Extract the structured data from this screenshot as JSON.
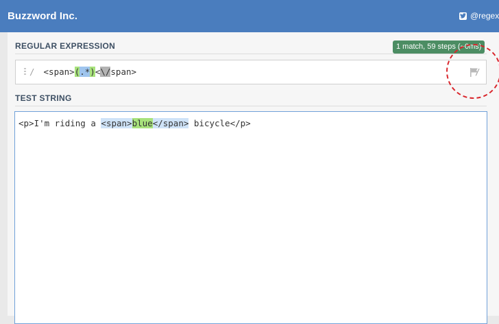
{
  "header": {
    "brand": "Buzzword Inc.",
    "twitter_handle": "@regex",
    "twitter_icon": "twitter-icon",
    "background_color": "#4a7dbe"
  },
  "regex_section": {
    "title": "REGULAR EXPRESSION",
    "match_info": "1 match, 59 steps (~0ms)",
    "match_info_color": "#4c8d63",
    "delimiter_open": "/",
    "delimiter_close": "/",
    "parts": {
      "prefix": " <span>",
      "group_open": "(",
      "token": ".*",
      "group_close": ")",
      "lt": "<",
      "escape": "\\/",
      "suffix": "span>"
    },
    "flags_icon": "flag-icon"
  },
  "test_section": {
    "title": "TEST STRING",
    "parts": {
      "before": "<p>I'm riding a ",
      "match_open": "<span>",
      "match_group": "blue",
      "match_close": "</span>",
      "after": " bicycle</p>"
    }
  },
  "colors": {
    "group_highlight": "#a8e27c",
    "token_highlight": "#9fc5ee",
    "match_highlight": "#cfe3f8",
    "annotation": "#d9262c"
  }
}
